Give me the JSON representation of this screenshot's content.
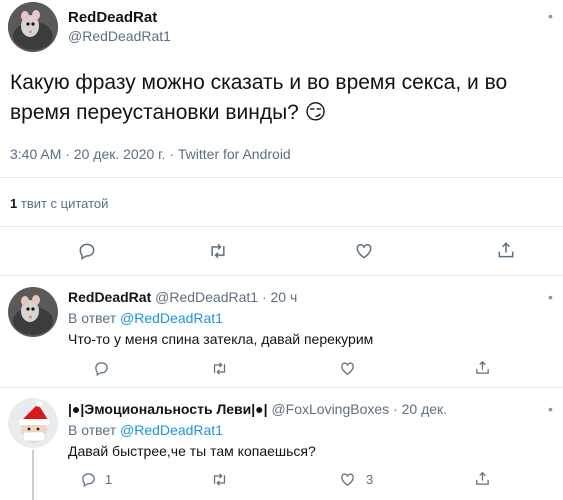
{
  "main_tweet": {
    "author_name": "RedDeadRat",
    "author_handle": "@RedDeadRat1",
    "text": "Какую фразу можно сказать и во время секса, и во время переустановки винды? 😏",
    "meta": "3:40 AM · 20 дек. 2020 г. · Twitter for Android",
    "quote_count": "1",
    "quote_label": "твит с цитатой",
    "avatar_icon": "rat-avatar-icon"
  },
  "reply1": {
    "author_name": "RedDeadRat",
    "author_handle": "@RedDeadRat1",
    "time": "· 20 ч",
    "reply_prefix": "В ответ",
    "reply_to": "@RedDeadRat1",
    "text": "Что-то у меня спина затекла, давай перекурим",
    "avatar_icon": "rat-avatar-icon"
  },
  "reply2": {
    "author_name": "|●|Эмоциональность Леви|●|",
    "author_handle": "@FoxLovingBoxes",
    "time": "· 20 дек.",
    "reply_prefix": "В ответ",
    "reply_to": "@RedDeadRat1",
    "text": "Давай быстрее,че ты там копаешься?",
    "reply_count": "1",
    "like_count": "3",
    "avatar_icon": "santa-avatar-icon"
  },
  "colors": {
    "link": "#1b95e0",
    "muted": "#5b7083",
    "divider": "#e6ecf0"
  }
}
